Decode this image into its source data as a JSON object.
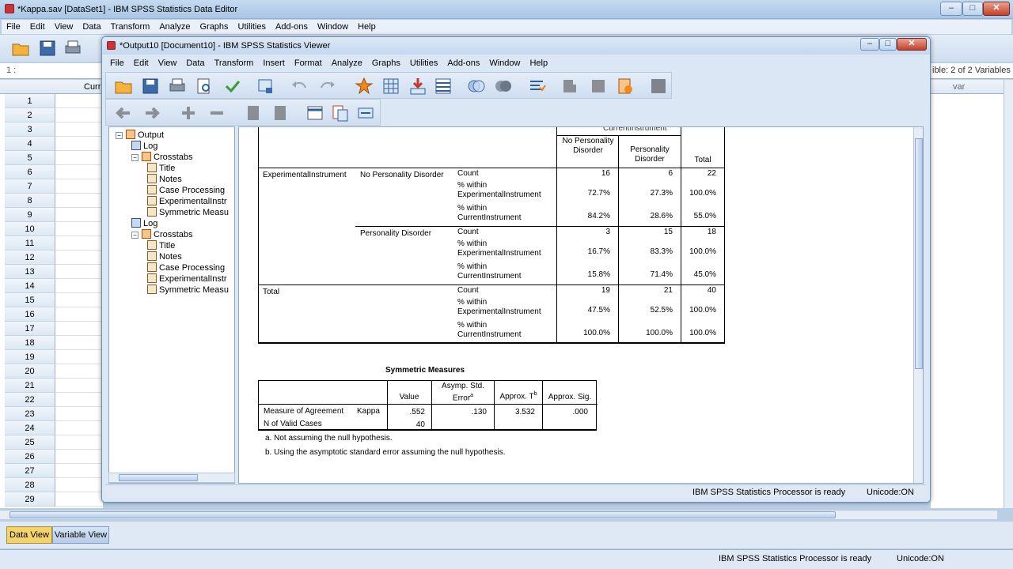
{
  "editor": {
    "title": "*Kappa.sav [DataSet1] - IBM SPSS Statistics Data Editor",
    "menu": [
      "File",
      "Edit",
      "View",
      "Data",
      "Transform",
      "Analyze",
      "Graphs",
      "Utilities",
      "Add-ons",
      "Window",
      "Help"
    ],
    "cell_ref": "1 :",
    "visible_vars": "ible: 2 of 2 Variables",
    "col_partial": "Curr",
    "col_var": "var",
    "rows": [
      "1",
      "2",
      "3",
      "4",
      "5",
      "6",
      "7",
      "8",
      "9",
      "10",
      "11",
      "12",
      "13",
      "14",
      "15",
      "16",
      "17",
      "18",
      "19",
      "20",
      "21",
      "22",
      "23",
      "24",
      "25",
      "26",
      "27",
      "28",
      "29"
    ],
    "tabs": {
      "data_view": "Data View",
      "variable_view": "Variable View"
    },
    "status": {
      "processor": "IBM SPSS Statistics Processor is ready",
      "unicode": "Unicode:ON"
    }
  },
  "viewer": {
    "title": "*Output10 [Document10] - IBM SPSS Statistics Viewer",
    "menu": [
      "File",
      "Edit",
      "View",
      "Data",
      "Transform",
      "Insert",
      "Format",
      "Analyze",
      "Graphs",
      "Utilities",
      "Add-ons",
      "Window",
      "Help"
    ],
    "outline": [
      {
        "label": "Output",
        "level": 0,
        "type": "book",
        "expand": "-"
      },
      {
        "label": "Log",
        "level": 1,
        "type": "log"
      },
      {
        "label": "Crosstabs",
        "level": 1,
        "type": "book",
        "expand": "-"
      },
      {
        "label": "Title",
        "level": 2,
        "type": "item"
      },
      {
        "label": "Notes",
        "level": 2,
        "type": "item"
      },
      {
        "label": "Case Processing",
        "level": 2,
        "type": "item"
      },
      {
        "label": "ExperimentalInstr",
        "level": 2,
        "type": "item"
      },
      {
        "label": "Symmetric Measu",
        "level": 2,
        "type": "item"
      },
      {
        "label": "Log",
        "level": 1,
        "type": "log"
      },
      {
        "label": "Crosstabs",
        "level": 1,
        "type": "book",
        "expand": "-"
      },
      {
        "label": "Title",
        "level": 2,
        "type": "item"
      },
      {
        "label": "Notes",
        "level": 2,
        "type": "item"
      },
      {
        "label": "Case Processing",
        "level": 2,
        "type": "item"
      },
      {
        "label": "ExperimentalInstr",
        "level": 2,
        "type": "item"
      },
      {
        "label": "Symmetric Measu",
        "level": 2,
        "type": "item"
      }
    ],
    "crosstab": {
      "top_partial": "CurrentInstrument",
      "col_headers": [
        "No Personality Disorder",
        "Personality Disorder",
        "Total"
      ],
      "row_var": "ExperimentalInstrument",
      "groups": [
        {
          "label": "No Personality Disorder",
          "rows": [
            {
              "stat": "Count",
              "vals": [
                "16",
                "6",
                "22"
              ]
            },
            {
              "stat": "% within ExperimentalInstrument",
              "vals": [
                "72.7%",
                "27.3%",
                "100.0%"
              ]
            },
            {
              "stat": "% within CurrentInstrument",
              "vals": [
                "84.2%",
                "28.6%",
                "55.0%"
              ]
            }
          ]
        },
        {
          "label": "Personality Disorder",
          "rows": [
            {
              "stat": "Count",
              "vals": [
                "3",
                "15",
                "18"
              ]
            },
            {
              "stat": "% within ExperimentalInstrument",
              "vals": [
                "16.7%",
                "83.3%",
                "100.0%"
              ]
            },
            {
              "stat": "% within CurrentInstrument",
              "vals": [
                "15.8%",
                "71.4%",
                "45.0%"
              ]
            }
          ]
        }
      ],
      "total_label": "Total",
      "total_rows": [
        {
          "stat": "Count",
          "vals": [
            "19",
            "21",
            "40"
          ]
        },
        {
          "stat": "% within ExperimentalInstrument",
          "vals": [
            "47.5%",
            "52.5%",
            "100.0%"
          ]
        },
        {
          "stat": "% within CurrentInstrument",
          "vals": [
            "100.0%",
            "100.0%",
            "100.0%"
          ]
        }
      ]
    },
    "symmetric": {
      "title": "Symmetric Measures",
      "headers": [
        "Value",
        "Asymp. Std. Error",
        "Approx. T",
        "Approx. Sig."
      ],
      "sup_a": "a",
      "sup_b": "b",
      "row1": {
        "label": "Measure of Agreement",
        "sub": "Kappa",
        "vals": [
          ".552",
          ".130",
          "3.532",
          ".000"
        ]
      },
      "row2": {
        "label": "N of Valid Cases",
        "vals": [
          "40"
        ]
      },
      "footnotes": [
        "a. Not assuming the null hypothesis.",
        "b. Using the asymptotic standard error assuming the null hypothesis."
      ]
    },
    "status": {
      "processor": "IBM SPSS Statistics Processor is ready",
      "unicode": "Unicode:ON"
    }
  }
}
